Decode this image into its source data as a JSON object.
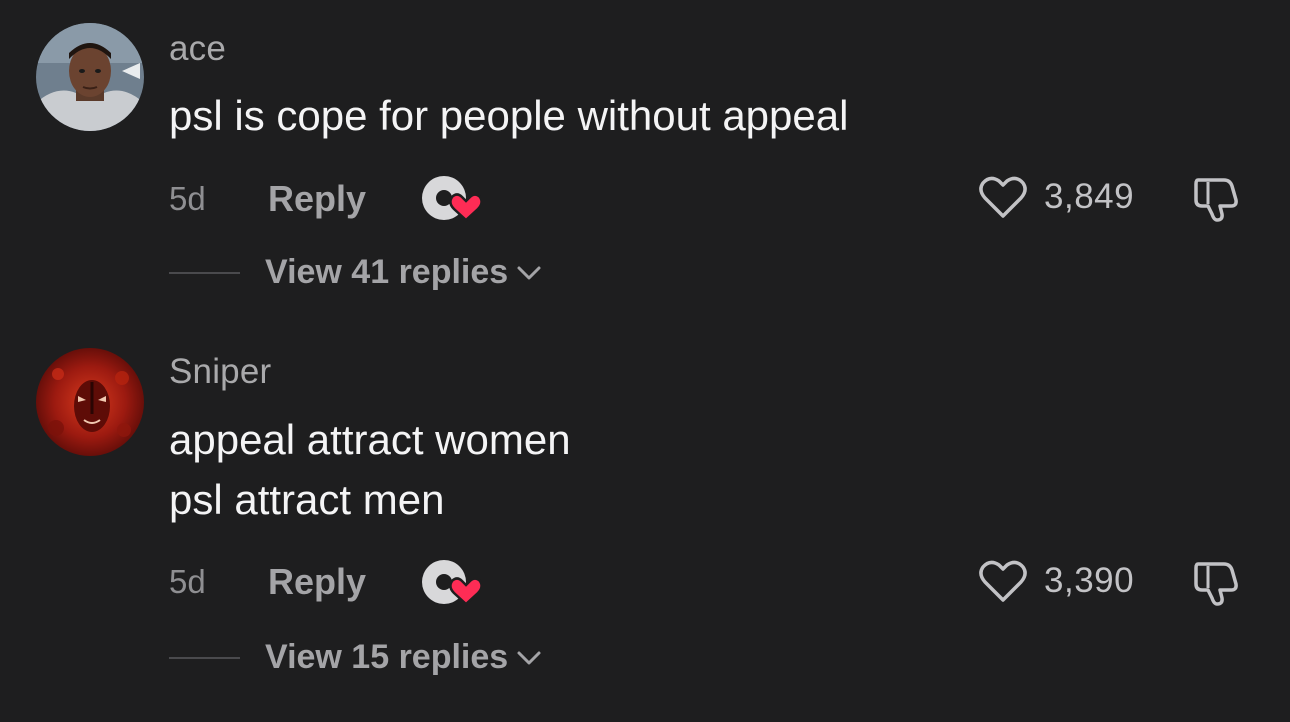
{
  "comments": [
    {
      "username": "ace",
      "text_lines": [
        "psl is cope for people without appeal"
      ],
      "age": "5d",
      "reply_label": "Reply",
      "likes": "3,849",
      "view_replies": "View 41 replies",
      "avatar_icon": "user-photo-avatar-icon"
    },
    {
      "username": "Sniper",
      "text_lines": [
        "appeal attract women",
        "psl attract men"
      ],
      "age": "5d",
      "reply_label": "Reply",
      "likes": "3,390",
      "view_replies": "View 15 replies",
      "avatar_icon": "red-mask-avatar-icon"
    }
  ],
  "colors": {
    "background": "#1e1e1f",
    "heart_accent": "#fe2c55",
    "text_primary": "#f4f4f5",
    "text_secondary": "#a4a4a7"
  }
}
